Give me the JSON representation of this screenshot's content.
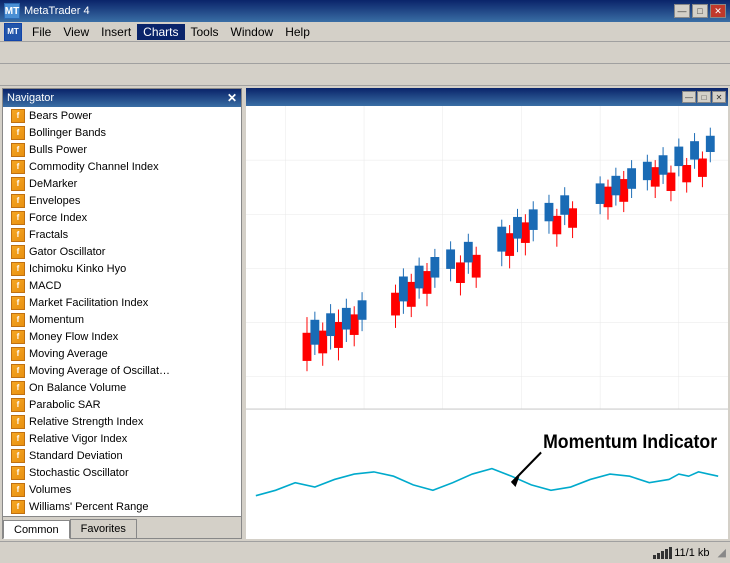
{
  "window": {
    "title": "MetaTrader 4",
    "icon": "MT"
  },
  "titlebar": {
    "controls": {
      "minimize": "—",
      "maximize": "□",
      "close": "✕"
    }
  },
  "menubar": {
    "app_icon": "MT",
    "items": [
      {
        "label": "File",
        "id": "file"
      },
      {
        "label": "View",
        "id": "view"
      },
      {
        "label": "Insert",
        "id": "insert"
      },
      {
        "label": "Charts",
        "id": "charts",
        "active": true
      },
      {
        "label": "Tools",
        "id": "tools"
      },
      {
        "label": "Window",
        "id": "window"
      },
      {
        "label": "Help",
        "id": "help"
      }
    ]
  },
  "navigator": {
    "title": "Navigator",
    "items": [
      {
        "label": "Bears Power",
        "id": "bears-power"
      },
      {
        "label": "Bollinger Bands",
        "id": "bollinger-bands"
      },
      {
        "label": "Bulls Power",
        "id": "bulls-power"
      },
      {
        "label": "Commodity Channel Index",
        "id": "cci"
      },
      {
        "label": "DeMarker",
        "id": "demarker"
      },
      {
        "label": "Envelopes",
        "id": "envelopes"
      },
      {
        "label": "Force Index",
        "id": "force-index"
      },
      {
        "label": "Fractals",
        "id": "fractals"
      },
      {
        "label": "Gator Oscillator",
        "id": "gator"
      },
      {
        "label": "Ichimoku Kinko Hyo",
        "id": "ichimoku"
      },
      {
        "label": "MACD",
        "id": "macd"
      },
      {
        "label": "Market Facilitation Index",
        "id": "mfi-bw"
      },
      {
        "label": "Momentum",
        "id": "momentum"
      },
      {
        "label": "Money Flow Index",
        "id": "money-flow"
      },
      {
        "label": "Moving Average",
        "id": "ma"
      },
      {
        "label": "Moving Average of Oscillat…",
        "id": "osma"
      },
      {
        "label": "On Balance Volume",
        "id": "obv"
      },
      {
        "label": "Parabolic SAR",
        "id": "parabolic"
      },
      {
        "label": "Relative Strength Index",
        "id": "rsi"
      },
      {
        "label": "Relative Vigor Index",
        "id": "rvi"
      },
      {
        "label": "Standard Deviation",
        "id": "stddev"
      },
      {
        "label": "Stochastic Oscillator",
        "id": "stochastic"
      },
      {
        "label": "Volumes",
        "id": "volumes"
      },
      {
        "label": "Williams' Percent Range",
        "id": "wpr"
      }
    ],
    "tabs": [
      {
        "label": "Common",
        "id": "common",
        "active": true
      },
      {
        "label": "Favorites",
        "id": "favorites"
      }
    ]
  },
  "chart": {
    "annotation": "Momentum Indicator"
  },
  "statusbar": {
    "info": "11/1 kb"
  }
}
